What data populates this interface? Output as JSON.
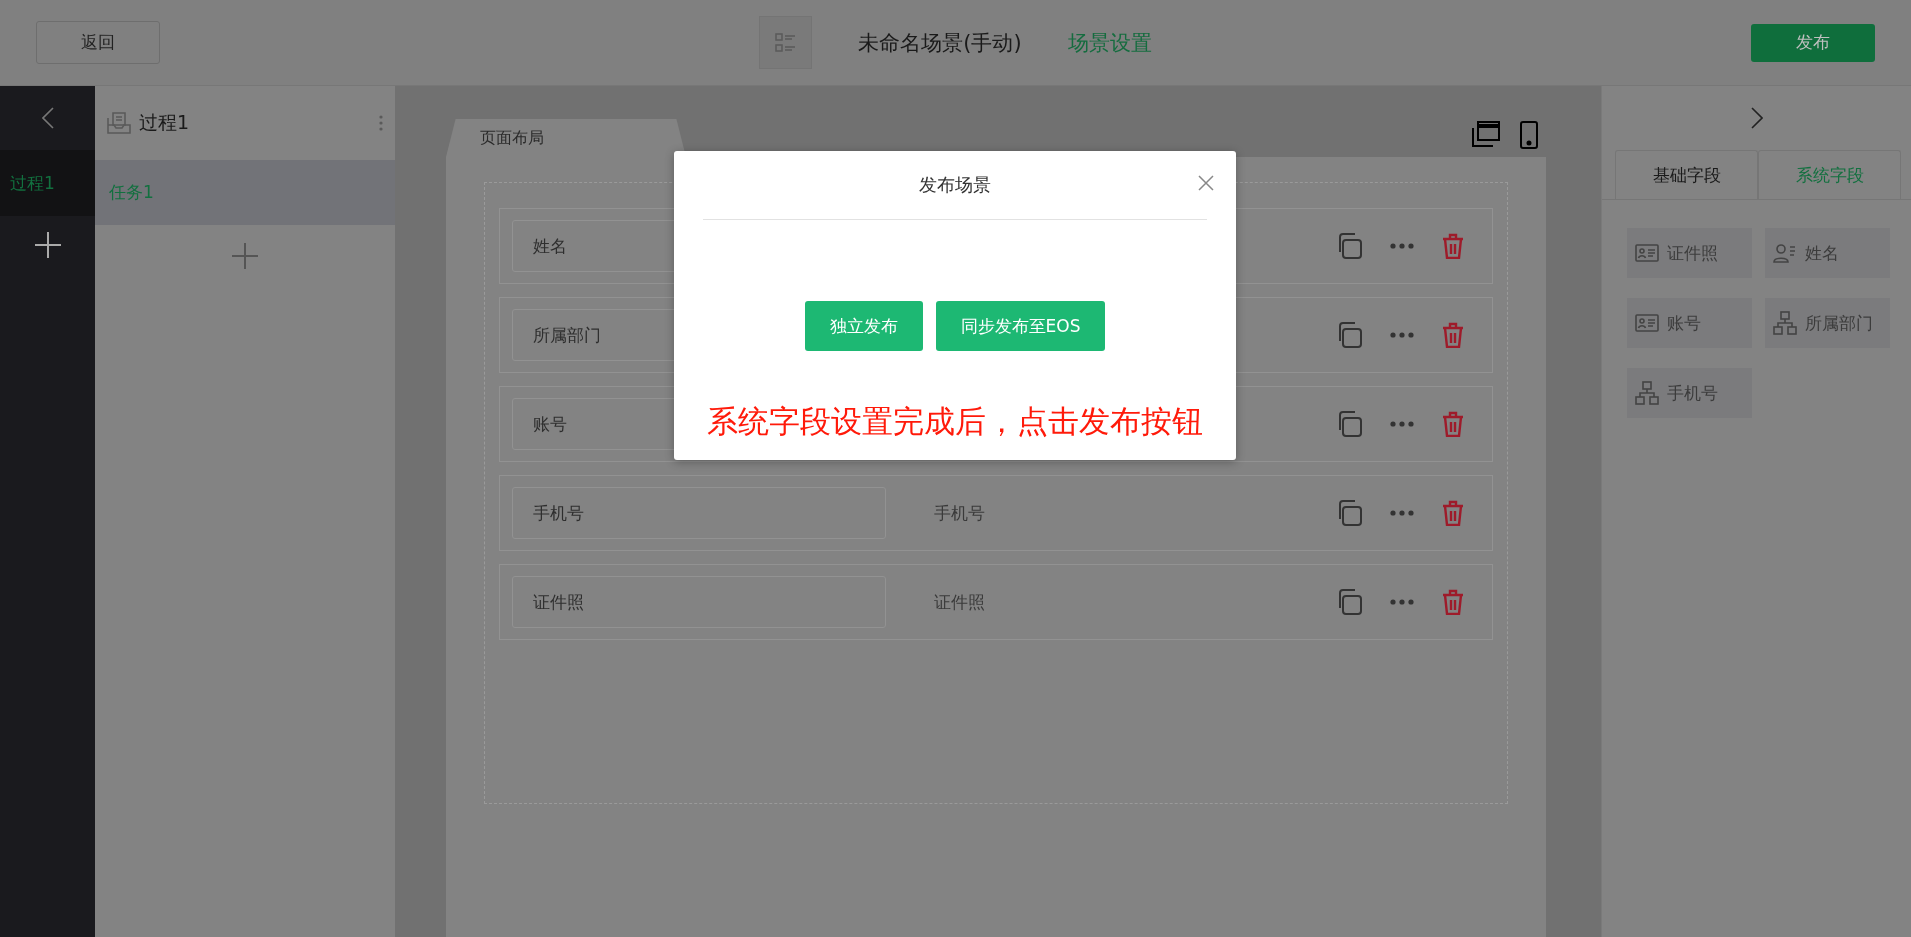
{
  "header": {
    "back": "返回",
    "title": "未命名场景(手动)",
    "settings_link": "场景设置",
    "publish": "发布"
  },
  "rail": {
    "items": [
      {
        "label": "过程1",
        "selected": true
      }
    ]
  },
  "process": {
    "title": "过程1",
    "tasks": [
      {
        "label": "任务1",
        "selected": true
      }
    ]
  },
  "canvas": {
    "tab": "页面布局"
  },
  "fields": [
    {
      "label": "姓名"
    },
    {
      "label": "所属部门"
    },
    {
      "label": "账号"
    },
    {
      "label": "手机号",
      "caption": "手机号"
    },
    {
      "label": "证件照",
      "caption": "证件照"
    }
  ],
  "panel": {
    "tabs": [
      {
        "label": "基础字段",
        "selected": false
      },
      {
        "label": "系统字段",
        "selected": true
      }
    ],
    "chips": [
      {
        "label": "证件照",
        "kind": "card"
      },
      {
        "label": "姓名",
        "kind": "person"
      },
      {
        "label": "账号",
        "kind": "card"
      },
      {
        "label": "所属部门",
        "kind": "org"
      },
      {
        "label": "手机号",
        "kind": "org"
      }
    ]
  },
  "dialog": {
    "title": "发布场景",
    "buttons": [
      "独立发布",
      "同步发布至EOS"
    ],
    "note": "系统字段设置完成后，点击发布按钮"
  }
}
